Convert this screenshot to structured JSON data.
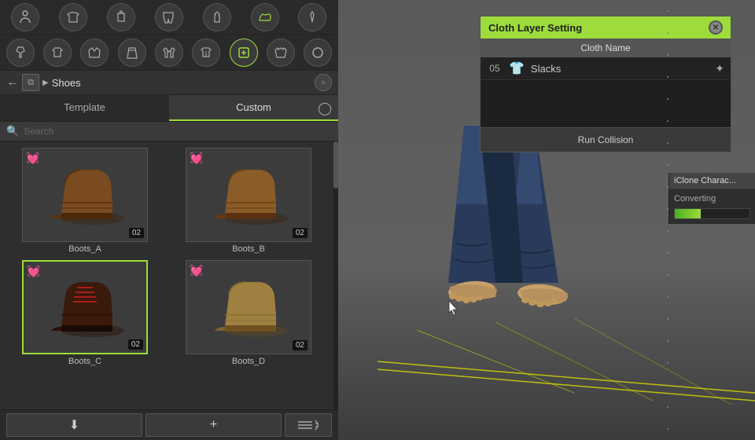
{
  "left_panel": {
    "top_icons_row1": [
      "person",
      "shirt",
      "body",
      "pants",
      "outfit",
      "shoes",
      "tie"
    ],
    "top_icons_row2": [
      "dress",
      "top",
      "suit-top",
      "skirt",
      "jacket",
      "shirt2",
      "active",
      "coat",
      "circle"
    ],
    "breadcrumb": {
      "back_icon": "←",
      "copy_icon": "⧉",
      "arrow_icon": "▶",
      "label": "Shoes",
      "menu_icon": "○"
    },
    "tabs": [
      {
        "id": "template",
        "label": "Template",
        "active": false
      },
      {
        "id": "custom",
        "label": "Custom",
        "active": true
      }
    ],
    "tab_menu_icon": "○",
    "search": {
      "placeholder": "Search",
      "icon": "🔍"
    },
    "grid_items": [
      {
        "id": "boots_a",
        "label": "Boots_A",
        "badge": "02",
        "selected": false,
        "color": "#6b4221"
      },
      {
        "id": "boots_b",
        "label": "Boots_B",
        "badge": "02",
        "selected": false,
        "color": "#7a5a35"
      },
      {
        "id": "boots_c",
        "label": "Boots_C",
        "badge": "02",
        "selected": true,
        "color": "#5a2a1a"
      },
      {
        "id": "boots_d",
        "label": "Boots_D",
        "badge": "02",
        "selected": false,
        "color": "#9b8050"
      }
    ],
    "bottom_toolbar": {
      "download_icon": "⬇",
      "add_icon": "+",
      "sort_icon": "≡⇅"
    }
  },
  "cloth_dialog": {
    "title": "Cloth Layer Setting",
    "close_icon": "✕",
    "cloth_name_label": "Cloth Name",
    "cloth_item": {
      "number": "05",
      "shirt_icon": "👕",
      "name": "Slacks",
      "settings_icon": "✦"
    },
    "run_collision_label": "Run Collision"
  },
  "iclone_panel": {
    "title": "iClone Charac...",
    "status": "Converting",
    "progress": 35
  },
  "viewport": {
    "floor_color": "#ffff00"
  }
}
